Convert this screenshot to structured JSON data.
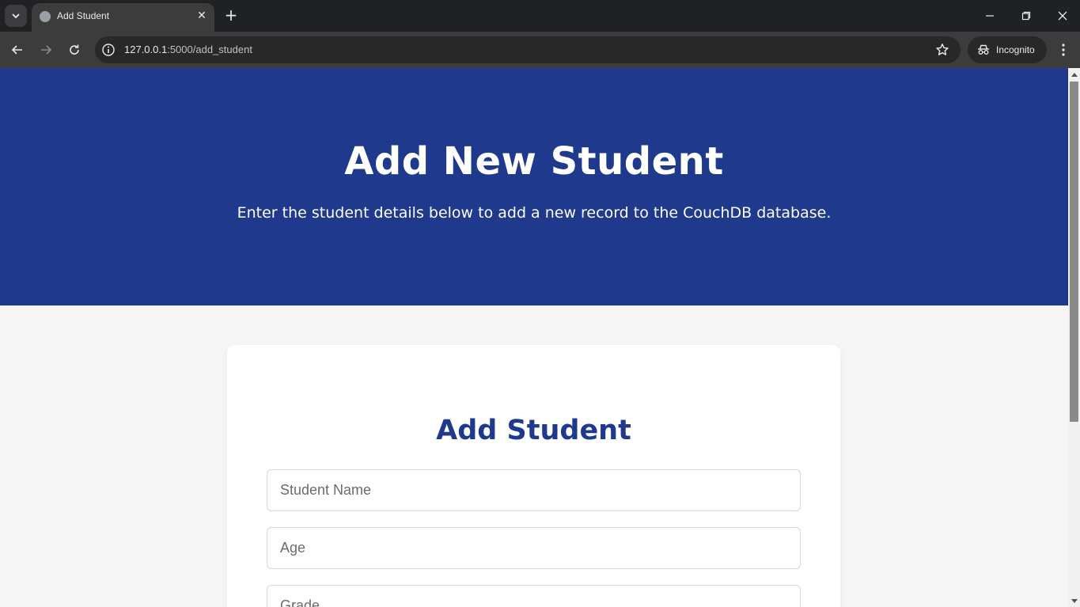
{
  "browser": {
    "tab_title": "Add Student",
    "url_host": "127.0.0.1",
    "url_path": ":5000/add_student",
    "profile_label": "Incognito",
    "icons": [
      "tab-search-icon",
      "globe-icon",
      "close-icon",
      "plus-icon",
      "minimize-icon",
      "restore-icon",
      "back-icon",
      "forward-icon",
      "reload-icon",
      "info-icon",
      "star-icon",
      "incognito-icon",
      "kebab-menu-icon"
    ]
  },
  "hero": {
    "title": "Add New Student",
    "subtitle": "Enter the student details below to add a new record to the CouchDB database.",
    "background_color": "#1f3a8c"
  },
  "form": {
    "heading": "Add Student",
    "fields": [
      {
        "name": "student-name-input",
        "placeholder": "Student Name"
      },
      {
        "name": "age-input",
        "placeholder": "Age"
      },
      {
        "name": "grade-input",
        "placeholder": "Grade"
      }
    ],
    "accent_color": "#1f3a8c"
  }
}
